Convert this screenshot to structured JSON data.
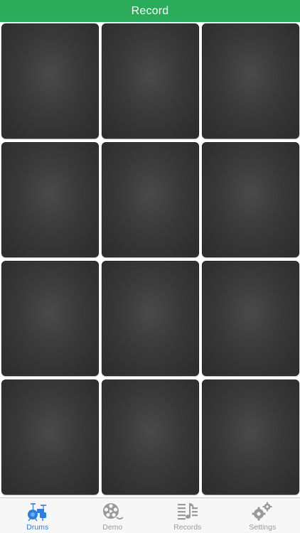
{
  "nav": {
    "title": "Record"
  },
  "pads": [
    {
      "id": 1
    },
    {
      "id": 2
    },
    {
      "id": 3
    },
    {
      "id": 4
    },
    {
      "id": 5
    },
    {
      "id": 6
    },
    {
      "id": 7
    },
    {
      "id": 8
    },
    {
      "id": 9
    },
    {
      "id": 10
    },
    {
      "id": 11
    },
    {
      "id": 12
    }
  ],
  "tabs": [
    {
      "label": "Drums",
      "icon": "drum-kit-icon",
      "active": true
    },
    {
      "label": "Demo",
      "icon": "film-reel-icon",
      "active": false
    },
    {
      "label": "Records",
      "icon": "music-list-icon",
      "active": false
    },
    {
      "label": "Settings",
      "icon": "gears-icon",
      "active": false
    }
  ],
  "colors": {
    "nav_bar": "#2bac5b",
    "active_tab": "#2a7de1",
    "inactive_tab": "#9a9a9a",
    "pad": "#3a3a3a"
  }
}
